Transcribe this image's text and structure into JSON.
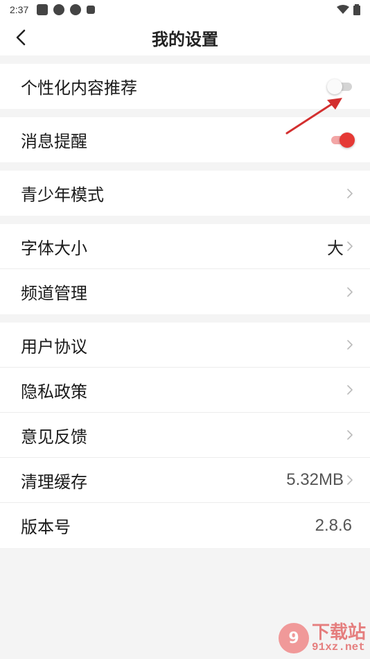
{
  "status_bar": {
    "time": "2:37"
  },
  "nav": {
    "title": "我的设置"
  },
  "groups": [
    [
      {
        "label": "个性化内容推荐",
        "toggle": false
      }
    ],
    [
      {
        "label": "消息提醒",
        "toggle": true
      }
    ],
    [
      {
        "label": "青少年模式"
      }
    ],
    [
      {
        "label": "字体大小",
        "value": "大"
      },
      {
        "label": "频道管理"
      }
    ],
    [
      {
        "label": "用户协议"
      },
      {
        "label": "隐私政策"
      },
      {
        "label": "意见反馈"
      },
      {
        "label": "清理缓存",
        "value": "5.32MB"
      },
      {
        "label": "版本号",
        "value": "2.8.6"
      }
    ]
  ],
  "watermark": {
    "title": "下载站",
    "url": "91xz.net"
  },
  "colors": {
    "accent": "#e53935",
    "background": "#f4f4f4"
  }
}
